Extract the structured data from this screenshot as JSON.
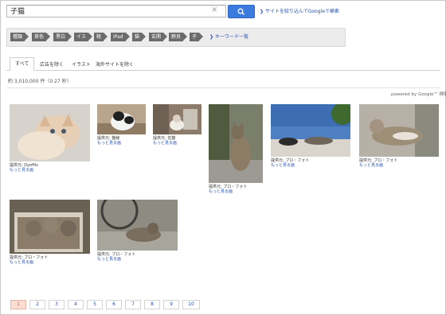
{
  "search": {
    "query": "子猫",
    "clear": "×",
    "site_link": "サイトを絞り込んでGoogleで検索"
  },
  "chips": [
    "種類",
    "茶色",
    "黒白",
    "イス",
    "靴",
    "iPad",
    "猫",
    "玄関",
    "野良",
    "子"
  ],
  "keyword_more": "キーワード一覧",
  "tabs": [
    "すべて",
    "広告を除く",
    "イラスト",
    "海外サイトを除く"
  ],
  "result_count": "約 3,010,000 件（0.27 秒）",
  "powered_by": "powered by Google™ 検索",
  "results": [
    {
      "source": "提供元: Dyoffix",
      "more": "もっと見る画"
    },
    {
      "source": "提供元: 猫様",
      "more": "もっと見る画"
    },
    {
      "source": "提供元: 花猫",
      "more": "もっと見る画"
    },
    {
      "source": "提供元: ブロ・フォト",
      "more": "もっと見る画"
    },
    {
      "source": "提供元: ブロ・フォト",
      "more": "もっと見る画"
    },
    {
      "source": "提供元: ブロ・フォト",
      "more": "もっと見る画"
    },
    {
      "source": "提供元: ブロ・フォト",
      "more": "もっと見る画"
    },
    {
      "source": "提供元: ブロ・フォト",
      "more": "もっと見る画"
    }
  ],
  "pagination": {
    "pages": [
      "1",
      "2",
      "3",
      "4",
      "5",
      "6",
      "7",
      "8",
      "9",
      "10"
    ],
    "current": "1"
  },
  "colors": {
    "accent": "#3b7be0",
    "link": "#2451b3",
    "chip": "#6b6b6b",
    "current_page": "#fbdcd0"
  },
  "icons": {
    "search": "search-icon",
    "clear": "close-icon",
    "arrow": "chevron-right-icon"
  }
}
